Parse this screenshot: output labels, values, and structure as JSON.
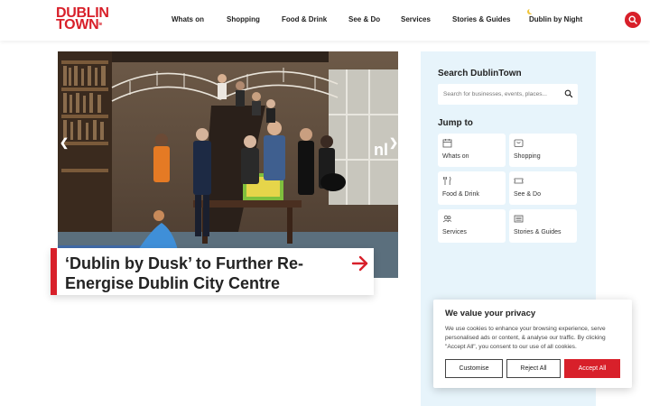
{
  "brand": {
    "line1": "DUBLIN",
    "line2": "TOWN",
    "mark": "ie",
    "accent": "#d8202a"
  },
  "nav": {
    "items": [
      {
        "label": "Whats on"
      },
      {
        "label": "Shopping"
      },
      {
        "label": "Food & Drink"
      },
      {
        "label": "See & Do"
      },
      {
        "label": "Services"
      },
      {
        "label": "Stories & Guides"
      },
      {
        "label": "Dublin by Night",
        "icon": "moon-icon"
      }
    ],
    "search_icon": "search-icon"
  },
  "hero": {
    "title": "‘Dublin by Dusk’ to Further Re-Energise Dublin City Centre",
    "prev_icon": "chevron-left-icon",
    "next_icon": "chevron-right-icon",
    "link_icon": "arrow-right-icon"
  },
  "sidebar": {
    "search_heading": "Search DublinTown",
    "search_placeholder": "Search for businesses, events, places...",
    "jump_heading": "Jump to",
    "tiles": [
      {
        "label": "Whats on",
        "icon": "calendar-icon"
      },
      {
        "label": "Shopping",
        "icon": "shopping-bag-icon"
      },
      {
        "label": "Food & Drink",
        "icon": "cutlery-icon"
      },
      {
        "label": "See & Do",
        "icon": "ticket-icon"
      },
      {
        "label": "Services",
        "icon": "people-icon"
      },
      {
        "label": "Stories & Guides",
        "icon": "newspaper-icon"
      }
    ]
  },
  "cookie": {
    "title": "We value your privacy",
    "text": "We use cookies to enhance your browsing experience, serve personalised ads or content, & analyse our traffic. By clicking \"Accept All\", you consent to our use of all cookies.",
    "customise": "Customise",
    "reject": "Reject All",
    "accept": "Accept All"
  }
}
